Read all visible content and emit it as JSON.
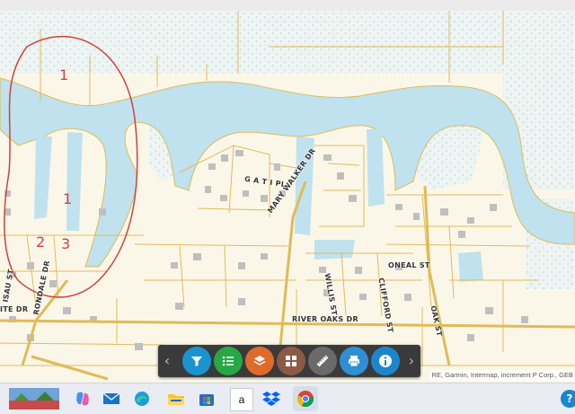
{
  "map": {
    "street_labels": [
      "G A T I PL",
      "MARY WALKER DR",
      "ONEAL ST",
      "WILLIS ST",
      "CLIFFORD ST",
      "OAK ST",
      "RIVER OAKS DR",
      "RONDALE DR",
      "ISAU ST",
      "ITE DR"
    ],
    "annotations": [
      "1",
      "1",
      "2",
      "3"
    ],
    "attribution": "RE, Garmin, Intermap, increment P Corp., GEB",
    "colors": {
      "land": "#fbf7e8",
      "water": "#bfe2ee",
      "roads": "#e0bb57",
      "ink": "#d2403d"
    }
  },
  "toolbar": {
    "prev": "‹",
    "next": "›",
    "tools": [
      {
        "icon": "filter-icon",
        "color": "#1a93cf"
      },
      {
        "icon": "list-icon",
        "color": "#27a845"
      },
      {
        "icon": "layers-icon",
        "color": "#e06a2c"
      },
      {
        "icon": "basemap-grid-icon",
        "color": "#8c5a44"
      },
      {
        "icon": "measure-ruler-icon",
        "color": "#6a6a6a"
      },
      {
        "icon": "print-icon",
        "color": "#2f8fd2"
      },
      {
        "icon": "info-icon",
        "color": "#1b86cc"
      }
    ]
  },
  "taskbar": {
    "items": [
      {
        "icon": "desktop-thumbnail-icon"
      },
      {
        "icon": "copilot-icon"
      },
      {
        "icon": "mail-icon"
      },
      {
        "icon": "edge-browser-icon"
      },
      {
        "icon": "file-explorer-icon"
      },
      {
        "icon": "store-icon"
      },
      {
        "icon": "amazon-icon",
        "label": "a"
      },
      {
        "icon": "dropbox-icon"
      },
      {
        "icon": "chrome-icon"
      },
      {
        "icon": "help-icon",
        "label": "?"
      }
    ]
  }
}
